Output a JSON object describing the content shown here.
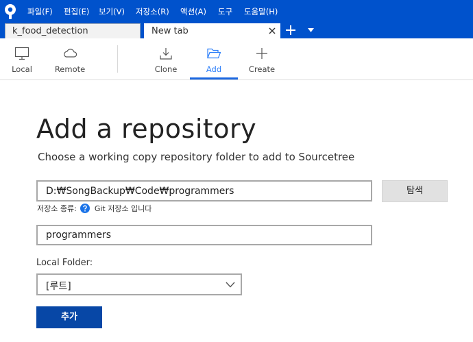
{
  "menu": {
    "items": [
      {
        "label": "파일(F)"
      },
      {
        "label": "편집(E)"
      },
      {
        "label": "보기(V)"
      },
      {
        "label": "저장소(R)"
      },
      {
        "label": "액션(A)"
      },
      {
        "label": "도구"
      },
      {
        "label": "도움말(H)"
      }
    ]
  },
  "tabs": [
    {
      "label": "k_food_detection"
    },
    {
      "label": "New tab"
    }
  ],
  "toolbar": {
    "local": "Local",
    "remote": "Remote",
    "clone": "Clone",
    "add": "Add",
    "create": "Create"
  },
  "main": {
    "title": "Add a repository",
    "subtitle": "Choose a working copy repository folder to add to Sourcetree",
    "path_value": "D:₩SongBackup₩Code₩programmers",
    "browse_label": "탐색",
    "repo_type_label": "저장소 종류:",
    "repo_type_value": "Git 저장소 입니다",
    "name_value": "programmers",
    "local_folder_label": "Local Folder:",
    "local_folder_value": "[루트]",
    "add_button": "추가"
  },
  "colors": {
    "header_bg": "#0052cc",
    "accent": "#2d7ff9",
    "primary_button": "#0747a6"
  }
}
